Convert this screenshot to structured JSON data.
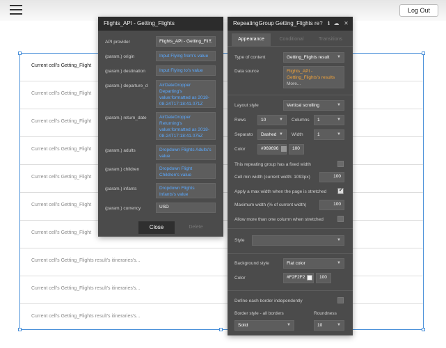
{
  "topbar": {
    "logout_label": "Log Out"
  },
  "repeating_group": {
    "rows": [
      "Current cell's Getting_Flight",
      "Current cell's Getting_Flight",
      "Current cell's Getting_Flight",
      "Current cell's Getting_Flight",
      "Current cell's Getting_Flight",
      "Current cell's Getting_Flight",
      "Current cell's Getting_Flight",
      "Current cell's Getting_Flights result's itineraries's...",
      "Current cell's Getting_Flights result's itineraries's...",
      "Current cell's Getting_Flights result's itineraries's..."
    ]
  },
  "api_panel": {
    "title": "Flights_API - Getting_Flights",
    "fields": [
      {
        "label": "API provider",
        "value": "Flights_API - Getting_Fli...",
        "kind": "dropdown"
      },
      {
        "label": "(param.) origin",
        "value": "Input Flying from's value",
        "kind": "dyn"
      },
      {
        "label": "(param.) destination",
        "value": "Input Flying to's value",
        "kind": "dyn"
      },
      {
        "label": "(param.) departure_d",
        "value": "AirDateDropper Departing's value:formatted as 2018-08-24T17:18:41.071Z",
        "kind": "dyn"
      },
      {
        "label": "(param.) return_date",
        "value": "AirDateDropper Returning's value:formatted as 2018-08-24T17:18:41.075Z",
        "kind": "dyn"
      },
      {
        "label": "(param.) adults",
        "value": "Dropdown Flights Adults's value",
        "kind": "dyn"
      },
      {
        "label": "(param.) children",
        "value": "Dropdown Flight Children's value",
        "kind": "dyn"
      },
      {
        "label": "(param.) infants",
        "value": "Dropdown Flights Infants's value",
        "kind": "dyn"
      },
      {
        "label": "(param.) currency",
        "value": "USD",
        "kind": "static"
      }
    ],
    "close_label": "Close",
    "delete_label": "Delete"
  },
  "rg_panel": {
    "title": "RepeatingGroup Getting_Flights re",
    "tabs": [
      "Appearance",
      "Conditional",
      "Transitions"
    ],
    "type_of_content_label": "Type of content",
    "type_of_content_value": "Getting_Flights result",
    "data_source_label": "Data source",
    "data_source_value": "Flights_API - Getting_Flights's results",
    "data_source_more": "More...",
    "layout_style_label": "Layout style",
    "layout_style_value": "Vertical scrolling",
    "rows_label": "Rows",
    "rows_value": "10",
    "columns_label": "Columns",
    "columns_value": "1",
    "separator_label": "Separato",
    "separator_value": "Dashed",
    "width_label": "Width",
    "width_value": "1",
    "color_label": "Color",
    "color_hex": "#969696",
    "color_opacity": "100",
    "fixed_width_label": "This repeating group has a fixed width",
    "cell_min_width_label": "Cell min width (current width: 1093px)",
    "cell_min_width_value": "100",
    "max_width_label": "Apply a max width when the page is stretched",
    "max_width_pct_label": "Maximum width (% of current width)",
    "max_width_pct_value": "100",
    "multi_column_label": "Allow more than one column when stretched",
    "style_label": "Style",
    "bg_style_label": "Background style",
    "bg_style_value": "Flat color",
    "bg_color_label": "Color",
    "bg_color_hex": "#F2F2F2",
    "bg_color_opacity": "100",
    "border_independent_label": "Define each border independently",
    "border_style_label": "Border style - all borders",
    "roundness_label": "Roundness",
    "border_style_value": "Solid",
    "roundness_value": "10",
    "colors": {
      "separator": "#969696",
      "background": "#F2F2F2"
    }
  }
}
